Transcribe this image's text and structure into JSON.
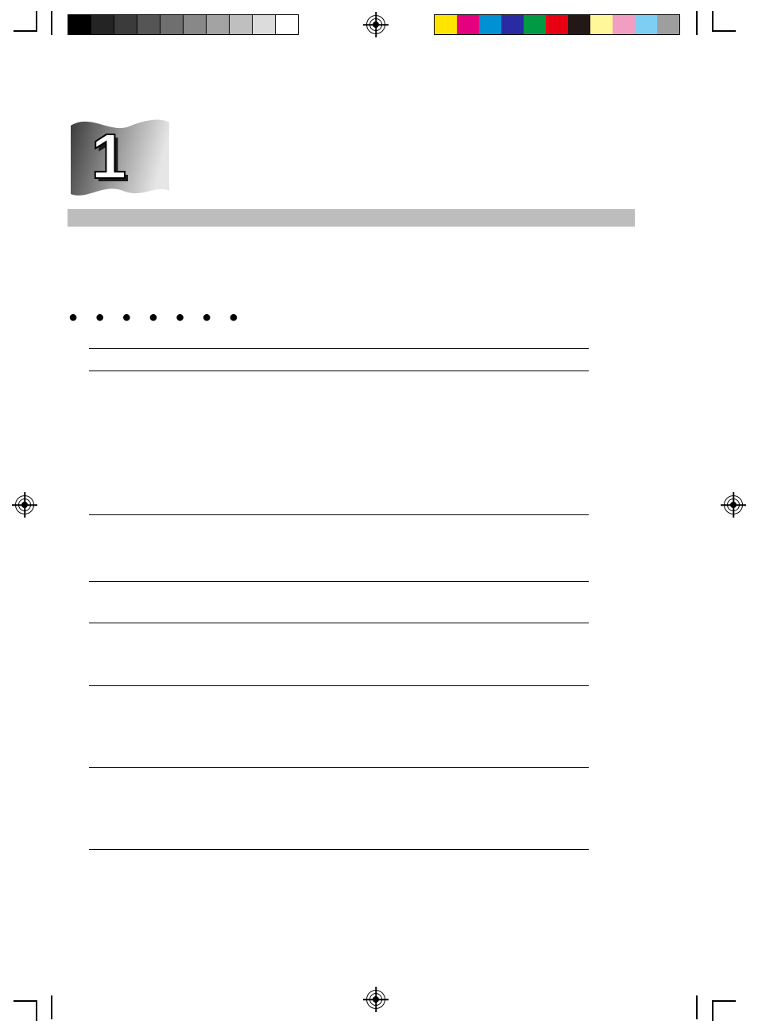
{
  "chapter": {
    "number": "1"
  },
  "printmarks": {
    "grayscale_swatches": [
      "#000000",
      "#242424",
      "#3b3b3b",
      "#555555",
      "#6f6f6f",
      "#888888",
      "#a3a3a3",
      "#bfbfbf",
      "#dcdcdc",
      "#ffffff"
    ],
    "color_swatches": [
      "#ffe400",
      "#e4007f",
      "#0091d4",
      "#2a2aa5",
      "#009944",
      "#e60012",
      "#231815",
      "#fff799",
      "#f19ec2",
      "#7ecef4",
      "#9e9e9e"
    ]
  },
  "dots": "●  ●  ●  ●  ●  ●  ●"
}
